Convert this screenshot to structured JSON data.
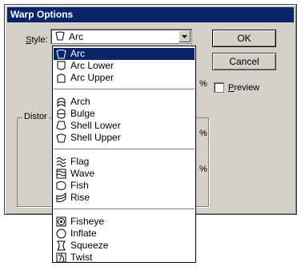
{
  "dialog": {
    "title": "Warp Options",
    "style_label_prefix": "S",
    "style_label_rest": "tyle:",
    "style_value": "Arc",
    "ok_label": "OK",
    "cancel_label": "Cancel",
    "preview_prefix": "P",
    "preview_rest": "review",
    "preview_checked": false,
    "percent_1": "%",
    "percent_2": "%",
    "percent_3": "%",
    "distortion_label": "Distor"
  },
  "dropdown": {
    "groups": [
      [
        {
          "label": "Arc",
          "icon": "arc-icon",
          "selected": true
        },
        {
          "label": "Arc Lower",
          "icon": "arc-lower-icon"
        },
        {
          "label": "Arc Upper",
          "icon": "arc-upper-icon"
        }
      ],
      [
        {
          "label": "Arch",
          "icon": "arch-icon"
        },
        {
          "label": "Bulge",
          "icon": "bulge-icon"
        },
        {
          "label": "Shell Lower",
          "icon": "shell-lower-icon"
        },
        {
          "label": "Shell Upper",
          "icon": "shell-upper-icon"
        }
      ],
      [
        {
          "label": "Flag",
          "icon": "flag-icon"
        },
        {
          "label": "Wave",
          "icon": "wave-icon"
        },
        {
          "label": "Fish",
          "icon": "fish-icon"
        },
        {
          "label": "Rise",
          "icon": "rise-icon"
        }
      ],
      [
        {
          "label": "Fisheye",
          "icon": "fisheye-icon"
        },
        {
          "label": "Inflate",
          "icon": "inflate-icon"
        },
        {
          "label": "Squeeze",
          "icon": "squeeze-icon"
        },
        {
          "label": "Twist",
          "icon": "twist-icon"
        }
      ]
    ]
  },
  "colors": {
    "face": "#d4d0c8",
    "title_bg": "#0a246a",
    "selection": "#0a246a"
  }
}
